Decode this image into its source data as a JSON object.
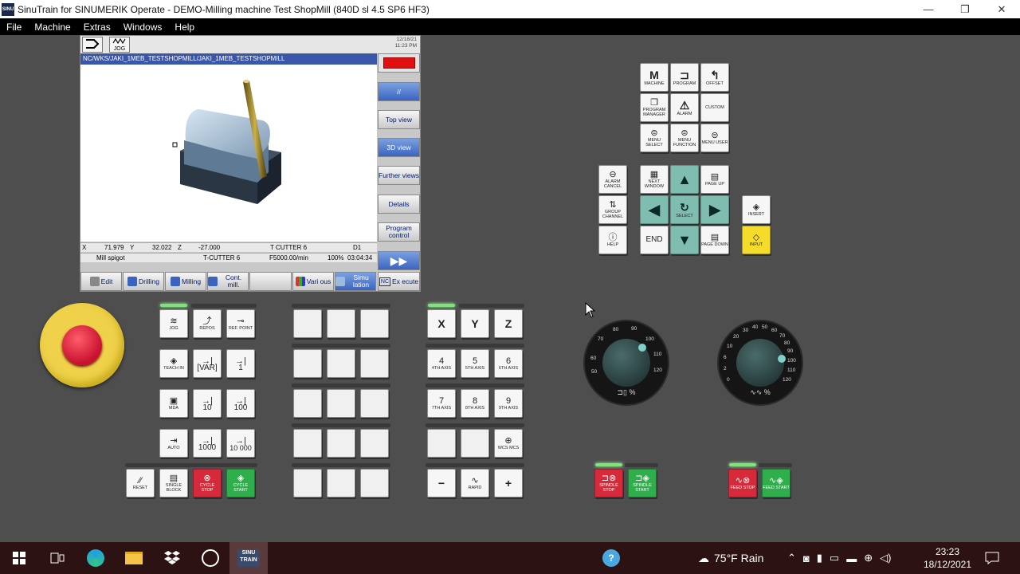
{
  "window": {
    "title": "SinuTrain for SINUMERIK Operate - DEMO-Milling machine Test ShopMill (840D sl 4.5 SP6 HF3)",
    "app_icon_label": "SINU",
    "minimize": "—",
    "maximize": "❐",
    "close": "✕"
  },
  "menu": [
    "File",
    "Machine",
    "Extras",
    "Windows",
    "Help"
  ],
  "screen": {
    "mode_icon_label": "JOG",
    "date": "12/18/21",
    "time": "11:23 PM",
    "path": "NC/WKS/JAKI_1MEB_TESTSHOPMILL/JAKI_1MEB_TESTSHOPMILL",
    "vertical_softkeys": [
      {
        "label": ""
      },
      {
        "label": "//"
      },
      {
        "label": "Top view"
      },
      {
        "label": "3D view",
        "active": true
      },
      {
        "label": "Further views"
      },
      {
        "label": "Details"
      },
      {
        "label": "Program control"
      },
      {
        "label": "▶▶"
      }
    ],
    "status": {
      "x_label": "X",
      "x_value": "71.979",
      "y_label": "Y",
      "y_value": "32.022",
      "z_label": "Z",
      "z_value": "-27.000",
      "tool": "T CUTTER 6",
      "d_no": "D1",
      "block": "Mill spigot",
      "tool2": "T-CUTTER 6",
      "feed": "F5000.00/min",
      "override": "100%",
      "runtime": "03:04:34"
    },
    "horizontal_softkeys": [
      {
        "label": "Edit"
      },
      {
        "label": "Drilling"
      },
      {
        "label": "Milling"
      },
      {
        "label": "Cont. mill."
      },
      {
        "label": ""
      },
      {
        "label": "Vari ous"
      },
      {
        "label": "Simu lation",
        "active": true
      },
      {
        "label": "Ex ecute",
        "prefix": "NC"
      }
    ]
  },
  "right_keypad": {
    "machine": "MACHINE",
    "program": "PROGRAM",
    "offset": "OFFSET",
    "program_manager": "PROGRAM MANAGER",
    "alarm": "ALARM",
    "custom": "CUSTOM",
    "menu_select": "MENU SELECT",
    "menu_function": "MENU FUNCTION",
    "menu_user": "MENU USER",
    "alarm_cancel": "ALARM CANCEL",
    "next_window": "NEXT WINDOW",
    "page_up": "PAGE UP",
    "group_channel": "GROUP CHANNEL",
    "select": "SELECT",
    "insert": "INSERT",
    "help": "HELP",
    "end": "END",
    "page_down": "PAGE DOWN",
    "input": "INPUT"
  },
  "mode_keys": {
    "jog": "JOG",
    "repos": "REPOS",
    "ref_point": "REF. POINT",
    "teach_in": "TEACH IN",
    "var": "[VAR]",
    "inc_1": "1",
    "mda": "MDA",
    "inc_10": "10",
    "inc_100": "100",
    "auto": "AUTO",
    "inc_1000": "1000",
    "inc_10000": "10 000",
    "reset": "RESET",
    "single_block": "SINGLE BLOCK",
    "cycle_stop": "CYCLE STOP",
    "cycle_start": "CYCLE START"
  },
  "axis_keys": {
    "x": "X",
    "y": "Y",
    "z": "Z",
    "a4": "4",
    "a4_lbl": "4TH AXIS",
    "a5": "5",
    "a5_lbl": "5TH AXIS",
    "a6": "6",
    "a6_lbl": "6TH AXIS",
    "a7": "7",
    "a7_lbl": "7TH AXIS",
    "a8": "8",
    "a8_lbl": "8TH AXIS",
    "a9": "9",
    "a9_lbl": "9TH AXIS",
    "wcs_mcs": "WCS MCS",
    "minus": "−",
    "rapid": "RAPID",
    "plus": "+"
  },
  "dials": {
    "spindle": {
      "ticks": [
        "50",
        "60",
        "70",
        "80",
        "90",
        "100",
        "110",
        "120"
      ],
      "label": "⊐▯ %"
    },
    "feed": {
      "ticks": [
        "0",
        "2",
        "6",
        "10",
        "20",
        "30",
        "40",
        "50",
        "60",
        "70",
        "80",
        "90",
        "100",
        "110",
        "120"
      ],
      "label": "∿∿ %"
    }
  },
  "spindle_keys": {
    "stop": "SPINDLE STOP",
    "start": "SPINDLE START"
  },
  "feed_keys": {
    "stop": "FEED STOP",
    "start": "FEED START"
  },
  "taskbar": {
    "sinu_line1": "SINU",
    "sinu_line2": "TRAIN",
    "weather": "75°F Rain",
    "clock_time": "23:23",
    "clock_date": "18/12/2021"
  }
}
